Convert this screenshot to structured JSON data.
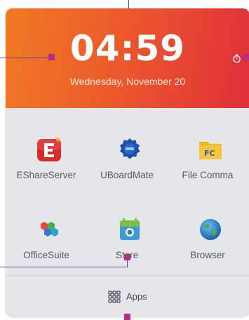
{
  "clock": {
    "time": "04:59",
    "date": "Wednesday, November 20"
  },
  "apps": [
    {
      "label": "EShareServer",
      "icon": "eshare-server-icon"
    },
    {
      "label": "UBoardMate",
      "icon": "uboardmate-icon"
    },
    {
      "label": "File Comma",
      "icon": "file-commander-icon"
    },
    {
      "label": "OfficeSuite",
      "icon": "officesuite-icon"
    },
    {
      "label": "Store",
      "icon": "store-icon"
    },
    {
      "label": "Browser",
      "icon": "browser-icon"
    }
  ],
  "apps_button": {
    "label": "Apps",
    "icon": "app-grid-icon"
  },
  "colors": {
    "header_start": "#f07a22",
    "header_end": "#df2f3b",
    "panel_bg": "#e4e6ea",
    "annotation_line": "#6b3fa0",
    "annotation_marker": "#b42e86"
  }
}
